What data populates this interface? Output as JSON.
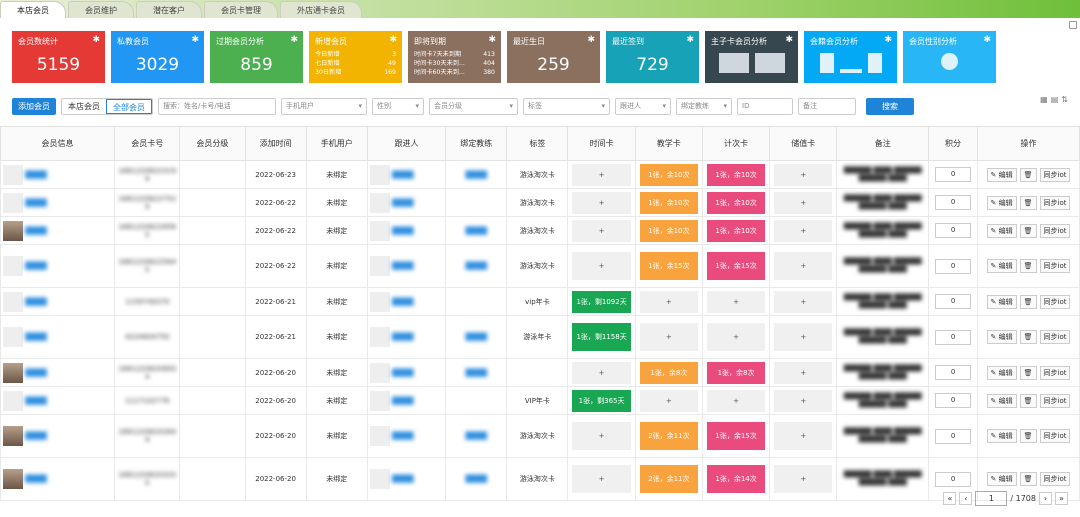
{
  "tabs": [
    {
      "label": "本店会员"
    },
    {
      "label": "会员维护"
    },
    {
      "label": "潜在客户"
    },
    {
      "label": "会员卡管理"
    },
    {
      "label": "外店通卡会员"
    }
  ],
  "colors": {
    "red": "#e53935",
    "blue": "#2196f3",
    "green": "#4caf50",
    "yellow": "#f2b400",
    "brown": "#8b6f5f",
    "teal": "#17a2b8",
    "navy": "#37474f",
    "sky": "#03a9f4",
    "cyan": "#29b6f6"
  },
  "cards": [
    {
      "title": "会员数统计",
      "value": "5159",
      "color": "#e53935"
    },
    {
      "title": "私教会员",
      "value": "3029",
      "color": "#2196f3"
    },
    {
      "title": "过期会员分析",
      "value": "859",
      "color": "#4caf50"
    },
    {
      "title": "新增会员",
      "color": "#f2b400",
      "rows": [
        {
          "k": "今日新增",
          "v": "3"
        },
        {
          "k": "七日新增",
          "v": "49"
        },
        {
          "k": "30日新增",
          "v": "169"
        }
      ]
    },
    {
      "title": "即将到期",
      "color": "#8b6f5f",
      "rows": [
        {
          "k": "时间卡7天未到期",
          "v": "413"
        },
        {
          "k": "时间卡30天未到...",
          "v": "404"
        },
        {
          "k": "时间卡60天未到...",
          "v": "380"
        }
      ]
    },
    {
      "title": "最近生日",
      "value": "259",
      "color": "#8b6f5f"
    },
    {
      "title": "最近签到",
      "value": "729",
      "color": "#17a2b8"
    },
    {
      "title": "主子卡会员分析",
      "color": "#37474f",
      "kind": "bars"
    },
    {
      "title": "会籍会员分析",
      "color": "#03a9f4",
      "kind": "chart"
    },
    {
      "title": "会员性别分析",
      "color": "#29b6f6",
      "kind": "circle"
    }
  ],
  "filters": {
    "add_label": "添加会员",
    "store_label": "本店会员",
    "all_label": "全部会员",
    "search_placeholder": "搜索：姓名/卡号/电话",
    "mobile_placeholder": "手机用户",
    "gender_placeholder": "性别",
    "level_placeholder": "会员分级",
    "tag_placeholder": "标签",
    "follow_placeholder": "跟进人",
    "coach_placeholder": "绑定教练",
    "id_placeholder": "ID",
    "note_placeholder": "备注",
    "search_label": "搜索"
  },
  "table": {
    "headers": [
      "会员信息",
      "会员卡号",
      "会员分级",
      "添加时间",
      "手机用户",
      "跟进人",
      "绑定教练",
      "标签",
      "时间卡",
      "教学卡",
      "计次卡",
      "储值卡",
      "备注",
      "积分",
      "操作"
    ],
    "rows": [
      {
        "card": "1681220622319 9",
        "date": "2022-06-23",
        "mobile": "未绑定",
        "tag": "游泳淘次卡",
        "time": "+",
        "teach": "1张，余10次",
        "count": "1张，余10次",
        "store": "+",
        "score": "0",
        "photo": false
      },
      {
        "card": "1681220622752 9",
        "date": "2022-06-22",
        "mobile": "未绑定",
        "tag": "游泳淘次卡",
        "time": "+",
        "teach": "1张，余10次",
        "count": "1张，余10次",
        "store": "+",
        "score": "0",
        "photo": false
      },
      {
        "card": "1681220622956 5",
        "date": "2022-06-22",
        "mobile": "未绑定",
        "tag": "游泳淘次卡",
        "time": "+",
        "teach": "1张，余10次",
        "count": "1张，余10次",
        "store": "+",
        "score": "0",
        "photo": true
      },
      {
        "card": "1681220622564 5",
        "date": "2022-06-22",
        "mobile": "未绑定",
        "tag": "游泳淘次卡",
        "time": "+",
        "teach": "1张，余15次",
        "count": "1张，余15次",
        "store": "+",
        "score": "0",
        "photo": false,
        "tall": true
      },
      {
        "card": "1159749370",
        "date": "2022-06-21",
        "mobile": "未绑定",
        "tag": "vip年卡",
        "time": "1张，剩1092天",
        "teach": "+",
        "count": "+",
        "store": "+",
        "score": "0",
        "photo": false
      },
      {
        "card": "4224804750",
        "date": "2022-06-21",
        "mobile": "未绑定",
        "tag": "游泳年卡",
        "time": "1张，剩1158天",
        "teach": "+",
        "count": "+",
        "store": "+",
        "score": "0",
        "photo": false,
        "tall": true
      },
      {
        "card": "1681220620993 4",
        "date": "2022-06-20",
        "mobile": "未绑定",
        "tag": "",
        "time": "+",
        "teach": "1张，余8次",
        "count": "1张，余8次",
        "store": "+",
        "score": "0",
        "photo": true
      },
      {
        "card": "1117102776",
        "date": "2022-06-20",
        "mobile": "未绑定",
        "tag": "VIP年卡",
        "time": "1张，剩365天",
        "teach": "+",
        "count": "+",
        "store": "+",
        "score": "0",
        "photo": false
      },
      {
        "card": "1681220620284 9",
        "date": "2022-06-20",
        "mobile": "未绑定",
        "tag": "游泳淘次卡",
        "time": "+",
        "teach": "2张，余11次",
        "count": "1张，余15次",
        "store": "+",
        "score": "0",
        "photo": true,
        "tall": true
      },
      {
        "card": "1681220620320 0",
        "date": "2022-06-20",
        "mobile": "未绑定",
        "tag": "游泳淘次卡",
        "time": "+",
        "teach": "2张，余11次",
        "count": "1张，余14次",
        "store": "+",
        "score": "0",
        "photo": true,
        "tall": true
      }
    ],
    "ops": {
      "edit": "编辑",
      "sync": "同步iot"
    }
  },
  "pager": {
    "page": "1",
    "total": "/ 1708"
  }
}
